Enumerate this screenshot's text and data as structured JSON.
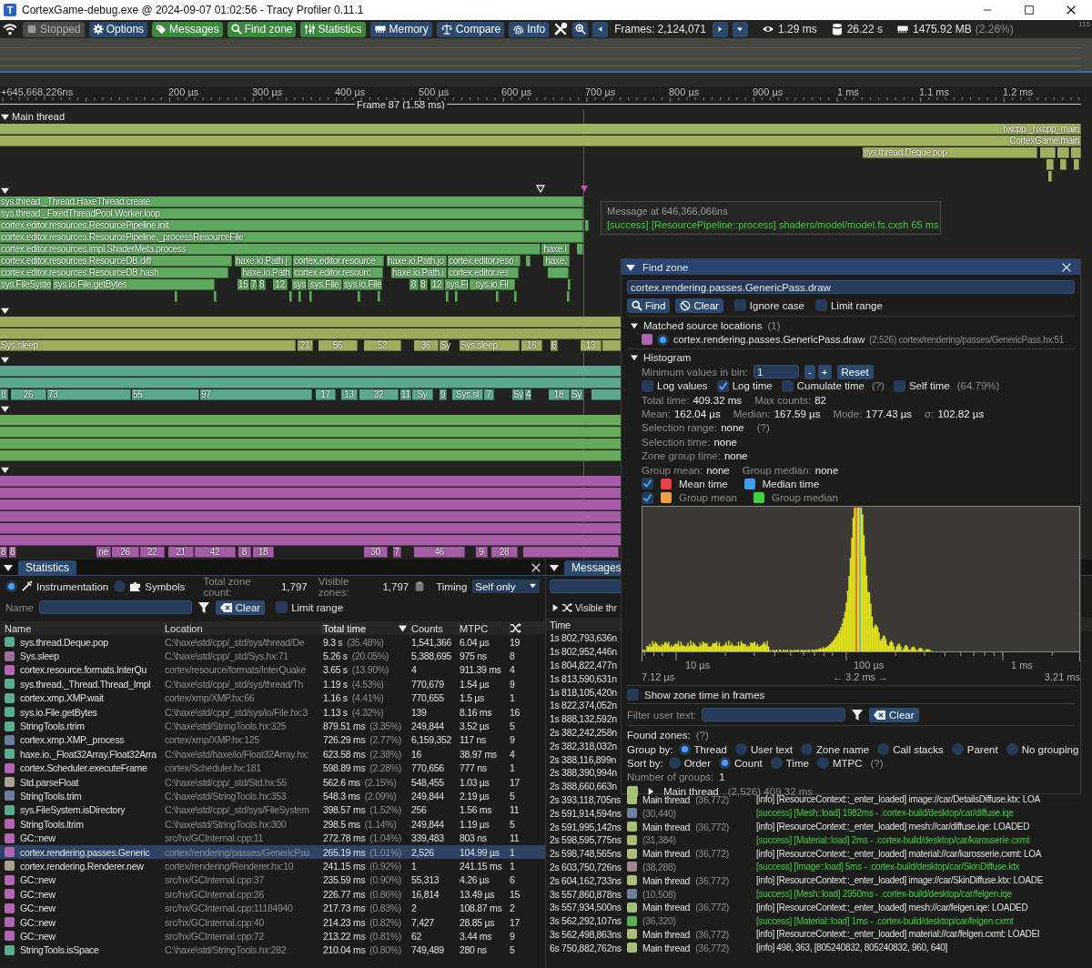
{
  "window": {
    "logo": "T",
    "title": "CortexGame-debug.exe @ 2024-09-07 01:02:56 - Tracy Profiler 0.11.1"
  },
  "toolbar": {
    "items": [
      {
        "kind": "icon"
      },
      {
        "kind": "toggle",
        "label": "Stopped",
        "on": false,
        "disabled": true
      },
      {
        "kind": "toggle",
        "label": "Options",
        "on": false,
        "disabled": false
      },
      {
        "kind": "toggle",
        "label": "Messages",
        "on": true,
        "disabled": false
      },
      {
        "kind": "toggle",
        "label": "Find zone",
        "on": true,
        "disabled": false
      },
      {
        "kind": "toggle",
        "label": "Statistics",
        "on": true,
        "disabled": false
      },
      {
        "kind": "toggle",
        "label": "Memory",
        "on": false,
        "disabled": false
      },
      {
        "kind": "toggle",
        "label": "Compare",
        "on": false,
        "disabled": false
      },
      {
        "kind": "toggle",
        "label": "Info",
        "on": false,
        "disabled": false
      },
      {
        "kind": "icon"
      },
      {
        "kind": "icon-button"
      },
      {
        "kind": "icon-button"
      },
      {
        "kind": "text",
        "label": "Frames: 2,124,071"
      },
      {
        "kind": "icon-button"
      },
      {
        "kind": "icon-button"
      },
      {
        "kind": "reading",
        "label": "1.29 ms"
      },
      {
        "kind": "reading",
        "label": "26.22 s"
      },
      {
        "kind": "reading",
        "label": "1475.92 MB",
        "note": "(2.26%)"
      }
    ],
    "corner_label": "115"
  },
  "ruler": {
    "start": "+645,668,226ns",
    "ticks": [
      "200 µs",
      "300 µs",
      "400 µs",
      "500 µs",
      "600 µs",
      "700 µs",
      "800 µs",
      "900 µs",
      "1 ms",
      "1.1 ms",
      "1.2 ms"
    ],
    "frame": "Frame 87 (1.58 ms)"
  },
  "timeline": {
    "tracks": [
      {
        "name": "Main thread",
        "expanded": true,
        "color": "#9db160",
        "zones": [
          "hxcpp._hxcpp_main",
          "CortexGame.main",
          "sys.thread.Deque.pop"
        ]
      },
      {
        "expanded": true,
        "color": "#5ea95e",
        "zones": [
          "sys.thread._Thread.HaxeThread.create",
          "sys.thread._FixedThreadPool.Worker.loop",
          "cortex.editor.resources.ResourcePipeline.init",
          "cortex.editor.resources.ResourcePipeline._processResourceFile",
          "cortex.editor.resources.impl.ShaderMeta.process",
          "haxe.i",
          "cortex.editor.resources.ResourceDB.diff",
          "haxe.io.Path.j",
          "cortex.editor.resource",
          "haxe.io.Path.jo",
          "cortex.editor.reso",
          "haxe.",
          "cortex.editor.resources.ResourceDB.hash",
          "haxe.io.Path",
          "cortex.editor.resourc",
          "haxe.io.Path.i",
          "cortex.editor.res",
          "sys.FileSyste",
          "sys.io.File.getBytes",
          "15",
          "7",
          "8",
          "12",
          "sys",
          "sys.File",
          "sys.io.File",
          "8",
          "8",
          "12",
          "sys.Fi",
          "sys.io.Fil"
        ]
      },
      {
        "expanded": true,
        "color": "#9cad5e",
        "zones": [
          "Sys.sleep",
          "21",
          "56",
          "52",
          "36",
          "Sy",
          "Sys.sleep",
          "16",
          "6",
          "13"
        ]
      },
      {
        "expanded": true,
        "color": "#5aa98a",
        "zones": [
          "8",
          "26",
          "73",
          "55",
          "97",
          "17",
          "13",
          "32",
          "11",
          "Sy",
          "9",
          "Sys.sl",
          "7",
          "Sy",
          "4",
          "18",
          "Sy"
        ]
      },
      {
        "expanded": true,
        "color": "#68aa5c"
      },
      {
        "expanded": true,
        "color": "#a65ca6",
        "zones": [
          "8",
          "8",
          "ne",
          "26",
          "22",
          "21",
          "42",
          "8",
          "18",
          "30",
          "7",
          "46",
          "9",
          "28"
        ]
      }
    ],
    "message_tooltip": {
      "title": "Message at 646,366,066ns",
      "text": "[success] [ResourcePipeline::process] shaders/model/model.fs.cxsh 65 ms"
    }
  },
  "find_zone": {
    "title": "Find zone",
    "expanded": true,
    "query": "cortex.rendering.passes.GenericPass.draw",
    "find_button": "Find",
    "clear_button": "Clear",
    "options": [
      {
        "label": "Ignore case",
        "checked": false
      },
      {
        "label": "Limit range",
        "checked": false
      }
    ],
    "matched": {
      "label": "Matched source locations",
      "count": "(1)",
      "expanded": true,
      "items": [
        {
          "color": "#b066b0",
          "selected": true,
          "name": "cortex.rendering.passes.GenericPass.draw",
          "count": "(2,526)",
          "location": "cortex/rendering/passes/GenericPass.hx:51"
        }
      ]
    },
    "histogram": {
      "label": "Histogram",
      "expanded": true,
      "min_label": "Minimum values in bin:",
      "min_value": "1",
      "minus": "-",
      "plus": "+",
      "reset": "Reset",
      "options": [
        {
          "label": "Log values",
          "checked": false
        },
        {
          "label": "Log time",
          "checked": true
        },
        {
          "label": "Cumulate time",
          "checked": false,
          "hint": "(?)"
        },
        {
          "label": "Self time",
          "checked": false,
          "hint": "(64.79%)"
        }
      ],
      "stats": [
        [
          {
            "label": "Total time:",
            "value": "409.32 ms"
          },
          {
            "label": "Max counts:",
            "value": "82"
          }
        ],
        [
          {
            "label": "Mean:",
            "value": "162.04 µs"
          },
          {
            "label": "Median:",
            "value": "167.59 µs"
          },
          {
            "label": "Mode:",
            "value": "177.43 µs"
          },
          {
            "label": "σ:",
            "value": "102.82 µs"
          }
        ],
        [
          {
            "label": "Selection range:",
            "value": "none",
            "hint": "(?)"
          }
        ],
        [
          {
            "label": "Selection time:",
            "value": "none"
          }
        ],
        [
          {
            "label": "Zone group time:",
            "value": "none"
          }
        ],
        [
          {
            "label": "Group mean:",
            "value": "none"
          },
          {
            "label": "Group median:",
            "value": "none"
          }
        ]
      ],
      "markers": [
        {
          "checked": true,
          "dimmed": false,
          "items": [
            {
              "label": "Mean time",
              "color": "#e84040"
            },
            {
              "label": "Median time",
              "color": "#40a0f0"
            }
          ]
        },
        {
          "checked": true,
          "dimmed": true,
          "items": [
            {
              "label": "Group mean",
              "color": "#f0a040"
            },
            {
              "label": "Group median",
              "color": "#40d040"
            }
          ]
        }
      ],
      "axis": {
        "ticks": [
          "10 µs",
          "100 µs",
          "1 ms"
        ],
        "min": "7.12 µs",
        "range": "← 3.2 ms →",
        "max": "3.21 ms"
      }
    },
    "show_frames": {
      "label": "Show zone time in frames",
      "checked": false
    },
    "filter": {
      "label": "Filter user text:",
      "clear": "Clear"
    },
    "found_label": "Found zones:",
    "found_hint": "(?)",
    "group_by": {
      "label": "Group by:",
      "options": [
        {
          "label": "Thread",
          "selected": true
        },
        {
          "label": "User text",
          "selected": false
        },
        {
          "label": "Zone name",
          "selected": false
        },
        {
          "label": "Call stacks",
          "selected": false
        },
        {
          "label": "Parent",
          "selected": false
        },
        {
          "label": "No grouping",
          "selected": false
        }
      ]
    },
    "sort_by": {
      "label": "Sort by:",
      "hint": "(?)",
      "options": [
        {
          "label": "Order",
          "selected": false
        },
        {
          "label": "Count",
          "selected": true
        },
        {
          "label": "Time",
          "selected": false
        },
        {
          "label": "MTPC",
          "selected": false
        }
      ]
    },
    "groups_label": "Number of groups:",
    "groups_value": "1",
    "groups": [
      {
        "color": "#a8bf78",
        "expanded": false,
        "name": "Main thread",
        "detail": "(2,526) 409.32 ms"
      }
    ]
  },
  "statistics": {
    "tab": "Statistics",
    "modes": [
      {
        "label": "Instrumentation",
        "selected": true
      },
      {
        "label": "Symbols",
        "selected": false
      }
    ],
    "total_label": "Total zone count:",
    "total": "1,797",
    "visible_label": "Visible zones:",
    "visible": "1,797",
    "timing_label": "Timing",
    "timing": "Self only",
    "name_label": "Name",
    "clear": "Clear",
    "limit": {
      "label": "Limit range",
      "checked": false
    },
    "columns": [
      {
        "label": "Name",
        "sorted": false
      },
      {
        "label": "Location",
        "sorted": false
      },
      {
        "label": "Total time",
        "sorted": true
      },
      {
        "label": "Counts",
        "sorted": false
      },
      {
        "label": "MTPC",
        "sorted": false
      }
    ],
    "rows": [
      {
        "color": "#5aae8e",
        "name": "sys.thread.Deque.pop",
        "location": "C:\\haxe\\std/cpp/_std/sys/thread/De",
        "time": "9.3 s",
        "percent": "(35.48%)",
        "count": "1,541,366",
        "mtpc": "6.04 µs",
        "threads": "19",
        "selected": false
      },
      {
        "color": "#9a6f9a",
        "name": "Sys.sleep",
        "location": "C:\\haxe\\std/cpp/_std/Sys.hx:71",
        "time": "5.26 s",
        "percent": "(20.05%)",
        "count": "5,388,695",
        "mtpc": "975 ns",
        "threads": "8",
        "selected": false
      },
      {
        "color": "#b066b0",
        "name": "cortex.resource.formats.InterQu",
        "location": "cortex/resource/formats/InterQuake",
        "time": "3.65 s",
        "percent": "(13.90%)",
        "count": "4",
        "mtpc": "911.39 ms",
        "threads": "4",
        "selected": false
      },
      {
        "color": "#5aae8e",
        "name": "sys.thread._Thread.Thread_Impl",
        "location": "C:\\haxe\\std/cpp/_std/sys/thread/Th",
        "time": "1.19 s",
        "percent": "(4.53%)",
        "count": "770,679",
        "mtpc": "1.54 µs",
        "threads": "9",
        "selected": false
      },
      {
        "color": "#5aae8e",
        "name": "cortex.xmp.XMP.wait",
        "location": "cortex/xmp/XMP.hx:66",
        "time": "1.16 s",
        "percent": "(4.41%)",
        "count": "770,655",
        "mtpc": "1.5 µs",
        "threads": "1",
        "selected": false
      },
      {
        "color": "#5aae8e",
        "name": "sys.io.File.getBytes",
        "location": "C:\\haxe\\std/cpp/_std/sys/io/File.hx:3",
        "time": "1.13 s",
        "percent": "(4.32%)",
        "count": "139",
        "mtpc": "8.16 ms",
        "threads": "16",
        "selected": false
      },
      {
        "color": "#5aae8e",
        "name": "StringTools.rtrim",
        "location": "C:\\haxe\\std/StringTools.hx:325",
        "time": "879.51 ms",
        "percent": "(3.35%)",
        "count": "249,844",
        "mtpc": "3.52 µs",
        "threads": "5",
        "selected": false
      },
      {
        "color": "#6a7fa0",
        "name": "cortex.xmp.XMP._process",
        "location": "cortex/xmp/XMP.hx:125",
        "time": "726.29 ms",
        "percent": "(2.77%)",
        "count": "6,159,352",
        "mtpc": "117 ns",
        "threads": "9",
        "selected": false
      },
      {
        "color": "#5aae8e",
        "name": "haxe.io._Float32Array.Float32Arra",
        "location": "C:\\haxe\\std/haxe/io/Float32Array.hx:",
        "time": "623.58 ms",
        "percent": "(2.38%)",
        "count": "16",
        "mtpc": "38.97 ms",
        "threads": "4",
        "selected": false
      },
      {
        "color": "#b066b0",
        "name": "cortex.Scheduler.executeFrame",
        "location": "cortex/Scheduler.hx:181",
        "time": "598.89 ms",
        "percent": "(2.28%)",
        "count": "770,656",
        "mtpc": "777 ns",
        "threads": "1",
        "selected": false
      },
      {
        "color": "#a8a290",
        "name": "Std.parseFloat",
        "location": "C:\\haxe\\std/cpp/_std/Std.hx:55",
        "time": "562.6 ms",
        "percent": "(2.15%)",
        "count": "548,455",
        "mtpc": "1.03 µs",
        "threads": "17",
        "selected": false
      },
      {
        "color": "#6a7fa0",
        "name": "StringTools.trim",
        "location": "C:\\haxe\\std/StringTools.hx:353",
        "time": "548.3 ms",
        "percent": "(2.09%)",
        "count": "249,844",
        "mtpc": "2.19 µs",
        "threads": "5",
        "selected": false
      },
      {
        "color": "#5aae8e",
        "name": "sys.FileSystem.isDirectory",
        "location": "C:\\haxe\\std/cpp/_std/sys/FileSystem",
        "time": "398.57 ms",
        "percent": "(1.52%)",
        "count": "256",
        "mtpc": "1.56 ms",
        "threads": "11",
        "selected": false
      },
      {
        "color": "#b066b0",
        "name": "StringTools.ltrim",
        "location": "C:\\haxe\\std/StringTools.hx:300",
        "time": "298.5 ms",
        "percent": "(1.14%)",
        "count": "249,844",
        "mtpc": "1.19 µs",
        "threads": "5",
        "selected": false
      },
      {
        "color": "#b066b0",
        "name": "GC::new",
        "location": "src/hx/GCInternal.cpp:11",
        "time": "272.78 ms",
        "percent": "(1.04%)",
        "count": "339,483",
        "mtpc": "803 ns",
        "threads": "11",
        "selected": false
      },
      {
        "color": "#b066b0",
        "name": "cortex.rendering.passes.Generic",
        "location": "cortex/rendering/passes/GenericPas",
        "time": "265.19 ms",
        "percent": "(1.01%)",
        "count": "2,526",
        "mtpc": "104.99 µs",
        "threads": "1",
        "selected": true
      },
      {
        "color": "#a8a290",
        "name": "cortex.rendering.Renderer.new",
        "location": "cortex/rendering/Renderer.hx:10",
        "time": "241.15 ms",
        "percent": "(0.92%)",
        "count": "1",
        "mtpc": "241.15 ms",
        "threads": "1",
        "selected": false
      },
      {
        "color": "#b066b0",
        "name": "GC::new",
        "location": "src/hx/GCInternal.cpp:37",
        "time": "235.59 ms",
        "percent": "(0.90%)",
        "count": "55,313",
        "mtpc": "4.26 µs",
        "threads": "6",
        "selected": false
      },
      {
        "color": "#b066b0",
        "name": "GC::new",
        "location": "src/hx/GCInternal.cpp:36",
        "time": "226.77 ms",
        "percent": "(0.86%)",
        "count": "16,814",
        "mtpc": "13.49 µs",
        "threads": "15",
        "selected": false
      },
      {
        "color": "#b066b0",
        "name": "GC::new",
        "location": "src/hx/GCInternal.cpp:11184940",
        "time": "217.73 ms",
        "percent": "(0.83%)",
        "count": "2",
        "mtpc": "108.87 ms",
        "threads": "2",
        "selected": false
      },
      {
        "color": "#b066b0",
        "name": "GC::new",
        "location": "src/hx/GCInternal.cpp:40",
        "time": "214.23 ms",
        "percent": "(0.82%)",
        "count": "7,427",
        "mtpc": "28.85 µs",
        "threads": "17",
        "selected": false
      },
      {
        "color": "#b066b0",
        "name": "GC::new",
        "location": "src/hx/GCInternal.cpp:72",
        "time": "213.22 ms",
        "percent": "(0.81%)",
        "count": "62",
        "mtpc": "3.44 ms",
        "threads": "9",
        "selected": false
      },
      {
        "color": "#5aae8e",
        "name": "StringTools.isSpace",
        "location": "C:\\haxe\\std/StringTools.hx:282",
        "time": "210.04 ms",
        "percent": "(0.80%)",
        "count": "749,489",
        "mtpc": "280 ns",
        "threads": "5",
        "selected": false
      }
    ]
  },
  "messages": {
    "tab": "Messages",
    "visible_threads": "Visible thr",
    "columns": [
      {
        "label": "Time"
      }
    ],
    "rows": [
      {
        "time": "1s 802,793,636n"
      },
      {
        "time": "1s 802,952,446n"
      },
      {
        "time": "1s 804,822,477n"
      },
      {
        "time": "1s 813,590,631n"
      },
      {
        "time": "1s 818,105,420n"
      },
      {
        "time": "1s 822,374,052n"
      },
      {
        "time": "1s 888,132,592n"
      },
      {
        "time": "2s 382,242,258n"
      },
      {
        "time": "2s 382,318,032n"
      },
      {
        "time": "2s 388,116,899n"
      },
      {
        "time": "2s 388,390,994n"
      },
      {
        "time": "2s 388,660,663n"
      },
      {
        "time": "2s 393,118,705ns",
        "color": "#a8bf78",
        "thread": "Main thread",
        "count": "(36,772)",
        "text": "[info] [ResourceContext::_enter_loaded] image://car/DetailsDiffuse.ktx: LOA",
        "kind": "info"
      },
      {
        "time": "2s 591,914,594ns",
        "color": "#7080a0",
        "count": "(30,440)",
        "text": "[success] [Mesh::load] 1982ms - .cortex-build/desktop/car/diffuse.iqe",
        "kind": "success"
      },
      {
        "time": "2s 591,995,142ns",
        "color": "#a8bf78",
        "thread": "Main thread",
        "count": "(36,772)",
        "text": "[info] [ResourceContext::_enter_loaded] mesh://car/diffuse.iqe: LOADED",
        "kind": "info"
      },
      {
        "time": "2s 598,595,775ns",
        "color": "#a8bf78",
        "count": "(31,384)",
        "text": "[success] [Material::load] 2ms - .cortex-build/desktop/car/karosserie.cxmt",
        "kind": "success"
      },
      {
        "time": "2s 598,748,565ns",
        "color": "#a8bf78",
        "thread": "Main thread",
        "count": "(36,772)",
        "text": "[info] [ResourceContext::_enter_loaded] material://car/karosserie.cxmt: LOA",
        "kind": "info"
      },
      {
        "time": "2s 603,750,726ns",
        "color": "#a08890",
        "count": "(38,288)",
        "text": "[success] [Image::load] 5ms - .cortex-build/desktop/car/SkinDiffuse.ktx",
        "kind": "success"
      },
      {
        "time": "2s 604,162,733ns",
        "color": "#a8bf78",
        "thread": "Main thread",
        "count": "(36,772)",
        "text": "[info] [ResourceContext::_enter_loaded] image://car/SkinDiffuse.ktx: LOADE",
        "kind": "info"
      },
      {
        "time": "3s 557,860,878ns",
        "color": "#6f7e9c",
        "count": "(10,508)",
        "text": "[success] [Mesh::load] 2950ms - .cortex-build/desktop/car/felgen.iqe",
        "kind": "success"
      },
      {
        "time": "3s 557,934,500ns",
        "color": "#a8bf78",
        "thread": "Main thread",
        "count": "(36,772)",
        "text": "[info] [ResourceContext::_enter_loaded] mesh://car/felgen.iqe: LOADED",
        "kind": "info"
      },
      {
        "time": "3s 562,292,107ns",
        "color": "#58b058",
        "count": "(36,320)",
        "text": "[success] [Material::load] 1ms - .cortex-build/desktop/car/felgen.cxmt",
        "kind": "success"
      },
      {
        "time": "3s 562,498,863ns",
        "color": "#a8bf78",
        "thread": "Main thread",
        "count": "(36,772)",
        "text": "[info] [ResourceContext::_enter_loaded] material://car/felgen.cxmt: LOADEI",
        "kind": "info"
      },
      {
        "time": "6s 750,882,762ns",
        "color": "#a8bf78",
        "thread": "Main thread",
        "count": "(36,772)",
        "text": "[info] 498, 363, [805240832, 805240832, 960, 640]",
        "kind": "info"
      }
    ]
  }
}
